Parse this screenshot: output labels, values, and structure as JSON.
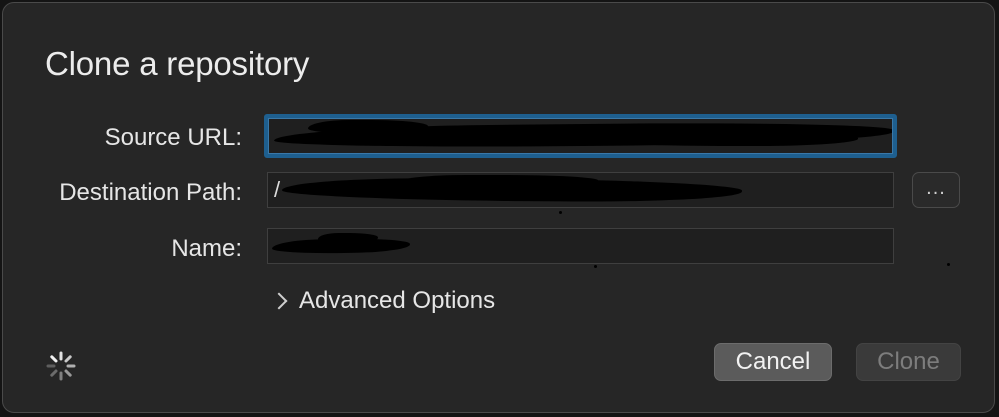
{
  "dialog": {
    "title": "Clone a repository"
  },
  "form": {
    "source_url": {
      "label": "Source URL:",
      "value": ""
    },
    "destination_path": {
      "label": "Destination Path:",
      "value": "/"
    },
    "name": {
      "label": "Name:",
      "value": ""
    },
    "browse_label": "..."
  },
  "advanced": {
    "label": "Advanced Options",
    "expanded": false
  },
  "buttons": {
    "cancel_label": "Cancel",
    "clone_label": "Clone",
    "clone_enabled": false
  },
  "status": {
    "loading": true
  },
  "colors": {
    "dialog_bg": "#262626",
    "focus_ring": "#1e5f8f",
    "cancel_bg": "#5b5b5b",
    "clone_disabled_text": "#7d7d7d"
  },
  "icons": {
    "spinner": "loading-spinner-icon",
    "advanced_toggle": "chevron-right-icon"
  }
}
